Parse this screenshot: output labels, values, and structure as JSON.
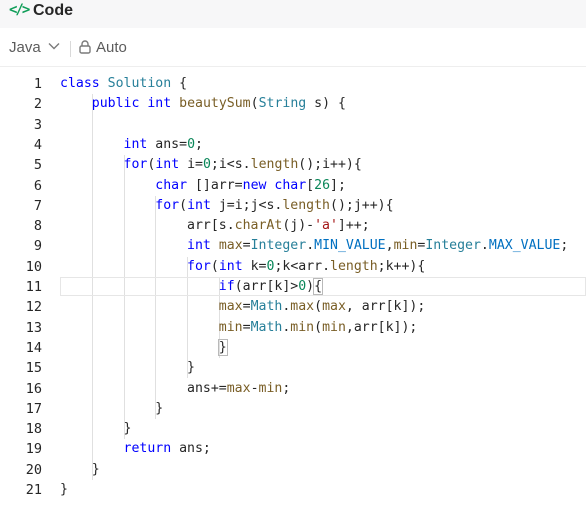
{
  "header": {
    "icon": "code-brackets-icon",
    "title": "Code",
    "accent_color": "#0f9d58"
  },
  "toolbar": {
    "language": "Java",
    "language_icon": "chevron-down-icon",
    "mode_icon": "lock-icon",
    "mode": "Auto"
  },
  "editor": {
    "active_line": 11,
    "lines": [
      {
        "number": "1",
        "code": "class Solution {"
      },
      {
        "number": "2",
        "code": "    public int beautySum(String s) {"
      },
      {
        "number": "3",
        "code": ""
      },
      {
        "number": "4",
        "code": "        int ans=0;"
      },
      {
        "number": "5",
        "code": "        for(int i=0;i<s.length();i++){"
      },
      {
        "number": "6",
        "code": "            char []arr=new char[26];"
      },
      {
        "number": "7",
        "code": "            for(int j=i;j<s.length();j++){"
      },
      {
        "number": "8",
        "code": "                arr[s.charAt(j)-'a']++;"
      },
      {
        "number": "9",
        "code": "                int max=Integer.MIN_VALUE,min=Integer.MAX_VALUE;"
      },
      {
        "number": "10",
        "code": "                for(int k=0;k<arr.length;k++){"
      },
      {
        "number": "11",
        "code": "                    if(arr[k]>0){"
      },
      {
        "number": "12",
        "code": "                    max=Math.max(max, arr[k]);"
      },
      {
        "number": "13",
        "code": "                    min=Math.min(min,arr[k]);"
      },
      {
        "number": "14",
        "code": "                    }"
      },
      {
        "number": "15",
        "code": "                }"
      },
      {
        "number": "16",
        "code": "                ans+=max-min;"
      },
      {
        "number": "17",
        "code": "            }"
      },
      {
        "number": "18",
        "code": "        }"
      },
      {
        "number": "19",
        "code": "        return ans;"
      },
      {
        "number": "20",
        "code": "    }"
      },
      {
        "number": "21",
        "code": "}"
      }
    ]
  }
}
